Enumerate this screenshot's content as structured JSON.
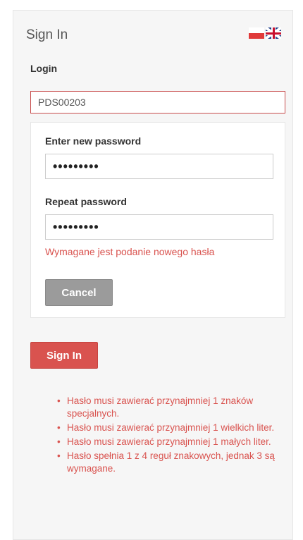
{
  "header": {
    "title": "Sign In",
    "flags": [
      "pl-flag-icon",
      "uk-flag-icon"
    ]
  },
  "login": {
    "label": "Login",
    "value": "PDS00203"
  },
  "new_password": {
    "label": "Enter new password",
    "value": "•••••••••"
  },
  "repeat_password": {
    "label": "Repeat password",
    "value": "•••••••••"
  },
  "error": "Wymagane jest podanie nowego hasła",
  "buttons": {
    "cancel": "Cancel",
    "sign_in": "Sign In"
  },
  "rules": [
    "Hasło musi zawierać przynajmniej 1 znaków specjalnych.",
    "Hasło musi zawierać przynajmniej 1 wielkich liter.",
    "Hasło musi zawierać przynajmniej 1 małych liter.",
    "Hasło spełnia 1 z 4 reguł znakowych, jednak 3 są wymagane."
  ],
  "colors": {
    "accent": "#d9534f",
    "cancel": "#9b9b9b",
    "panel": "#f6f6f6"
  }
}
